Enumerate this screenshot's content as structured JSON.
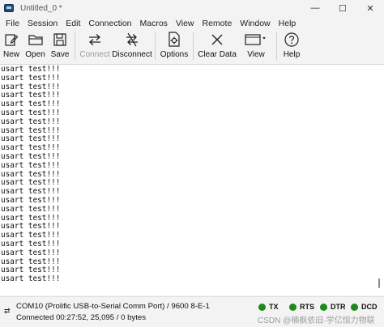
{
  "window": {
    "title": "Untitled_0 *",
    "controls": {
      "minimize": "—",
      "maximize": "☐",
      "close": "✕"
    }
  },
  "menu": [
    "File",
    "Session",
    "Edit",
    "Connection",
    "Macros",
    "View",
    "Remote",
    "Window",
    "Help"
  ],
  "toolbar": {
    "new": "New",
    "open": "Open",
    "save": "Save",
    "connect": "Connect",
    "disconnect": "Disconnect",
    "options": "Options",
    "clear_data": "Clear Data",
    "view": "View",
    "help": "Help"
  },
  "terminal": {
    "line_text": "usart test!!!",
    "visible_line_count": 25
  },
  "status": {
    "port_info": "COM10 (Prolific USB-to-Serial Comm Port) / 9600 8-E-1",
    "connection_info": "Connected 00:27:52, 25,095 / 0 bytes"
  },
  "indicators": [
    {
      "label": "TX",
      "color": "#1e8a1e"
    },
    {
      "label": "RTS",
      "color": "#1e8a1e"
    },
    {
      "label": "DTR",
      "color": "#1e8a1e"
    },
    {
      "label": "DCD",
      "color": "#1e8a1e"
    }
  ],
  "watermark": "CSDN @楠枫依旧·学亿恒力物联"
}
